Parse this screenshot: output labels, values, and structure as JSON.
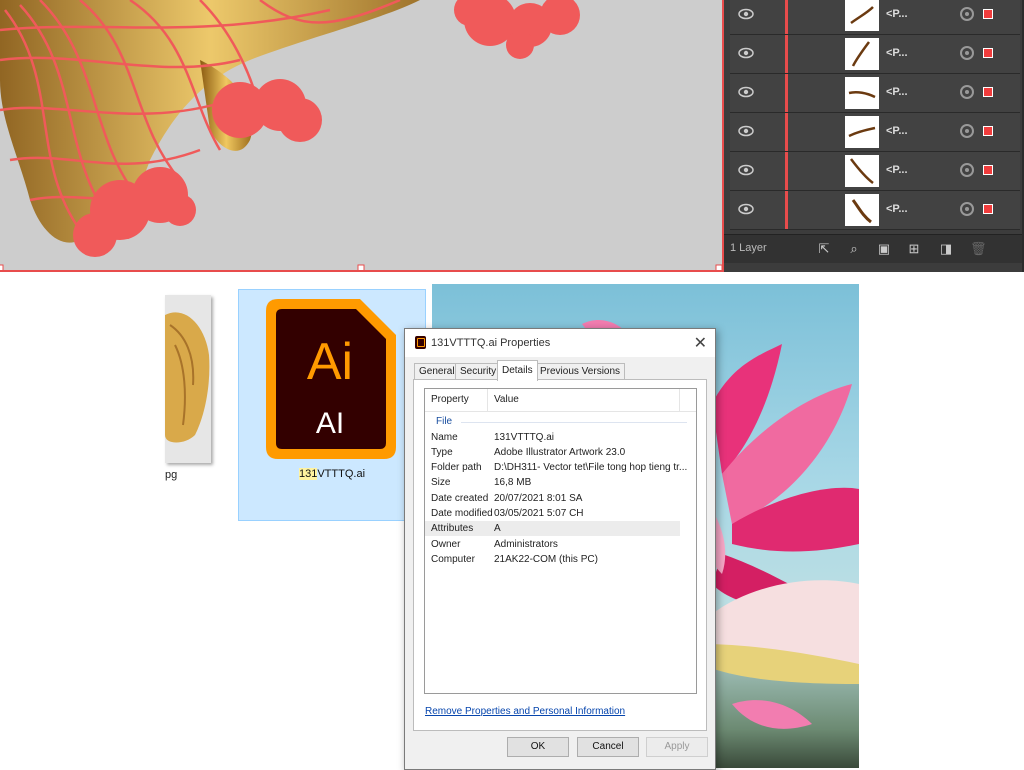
{
  "illustrator": {
    "layers_panel": {
      "rows": [
        {
          "name": "<P..."
        },
        {
          "name": "<P..."
        },
        {
          "name": "<P..."
        },
        {
          "name": "<P..."
        },
        {
          "name": "<P..."
        },
        {
          "name": "<P..."
        }
      ],
      "layer_count": "1 Layer"
    }
  },
  "explorer": {
    "left_file_label": "pg",
    "ai_file": {
      "icon_big_text": "Ai",
      "icon_small_text": "AI",
      "label_highlight": "131",
      "label_rest": "VTTTQ.ai"
    }
  },
  "dialog": {
    "title": "131VTTTQ.ai Properties",
    "tabs": [
      "General",
      "Security",
      "Details",
      "Previous Versions"
    ],
    "active_tab": "Details",
    "columns": {
      "property": "Property",
      "value": "Value"
    },
    "group": "File",
    "properties": [
      {
        "key": "Name",
        "value": "131VTTTQ.ai"
      },
      {
        "key": "Type",
        "value": "Adobe Illustrator Artwork 23.0"
      },
      {
        "key": "Folder path",
        "value": "D:\\DH311- Vector tet\\File tong hop tieng tr..."
      },
      {
        "key": "Size",
        "value": "16,8 MB"
      },
      {
        "key": "Date created",
        "value": "20/07/2021 8:01 SA"
      },
      {
        "key": "Date modified",
        "value": "03/05/2021 5:07 CH"
      },
      {
        "key": "Attributes",
        "value": "A"
      },
      {
        "key": "Owner",
        "value": "Administrators"
      },
      {
        "key": "Computer",
        "value": "21AK22-COM (this PC)"
      }
    ],
    "remove_link": "Remove Properties and Personal Information",
    "buttons": {
      "ok": "OK",
      "cancel": "Cancel",
      "apply": "Apply"
    }
  },
  "colors": {
    "accent": "#e84c4c",
    "ai_orange": "#ff9a00",
    "ai_bg": "#330000",
    "selection": "#cce8ff"
  }
}
